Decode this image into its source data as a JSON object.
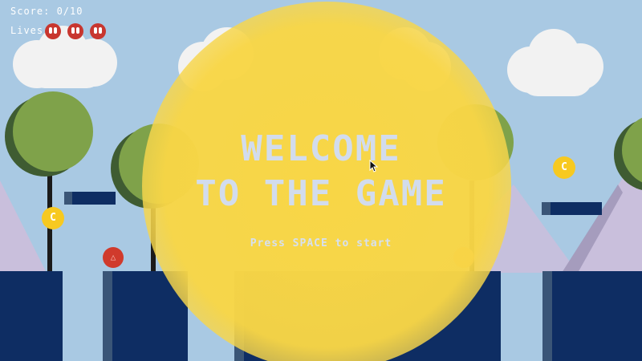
{
  "hud": {
    "score_text": "Score: 0/10",
    "score_current": 0,
    "score_total": 10,
    "lives_label": "Lives:",
    "lives_count": 3
  },
  "overlay": {
    "title_line1": "WELCOME",
    "title_line2": "TO THE GAME",
    "prompt": "Press SPACE to start"
  },
  "coins": [
    {
      "label": "C"
    },
    {
      "label": "C"
    }
  ],
  "enemies": [
    {
      "glyph": "△"
    },
    {
      "glyph": "△"
    }
  ],
  "colors": {
    "sky": "#a9c9e3",
    "pillar": "#0e2d63",
    "sun": "#f8d646",
    "coin": "#f7c920",
    "enemy": "#d03a2c",
    "tree": "#7fa24a",
    "mountain": "#c9bfdc"
  }
}
